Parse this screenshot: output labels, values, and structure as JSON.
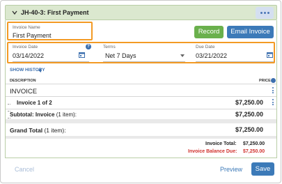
{
  "header": {
    "title": "JH-40-3: First Payment"
  },
  "invoice_name": {
    "label": "Invoice Name",
    "value": "First Payment"
  },
  "actions": {
    "record": "Record",
    "email": "Email Invoice"
  },
  "invoice_date": {
    "label": "Invoice Date",
    "value": "03/14/2022"
  },
  "terms": {
    "label": "Terms",
    "value": "Net 7 Days"
  },
  "due_date": {
    "label": "Due Date",
    "value": "03/21/2022"
  },
  "show_history": "SHOW HISTORY",
  "table": {
    "col_description": "DESCRIPTION",
    "col_price": "PRICE",
    "section_title": "INVOICE",
    "line_item": {
      "label": "Invoice 1 of 2",
      "price": "$7,250.00"
    },
    "subtotal": {
      "label": "Subtotal: Invoice",
      "count": "(1 item):",
      "price": "$7,250.00"
    },
    "grand_total": {
      "label": "Grand Total",
      "count": "(1 item):",
      "price": "$7,250.00"
    }
  },
  "totals": {
    "invoice_total_label": "Invoice Total:",
    "invoice_total_value": "$7,250.00",
    "balance_due_label": "Invoice Balance Due:",
    "balance_due_value": "$7,250.00"
  },
  "footer": {
    "cancel": "Cancel",
    "preview": "Preview",
    "save": "Save"
  },
  "colors": {
    "accent_blue": "#3c7ab8",
    "green": "#6ab04c",
    "orange_highlight": "#f39a24",
    "balance_red": "#d0312d"
  }
}
